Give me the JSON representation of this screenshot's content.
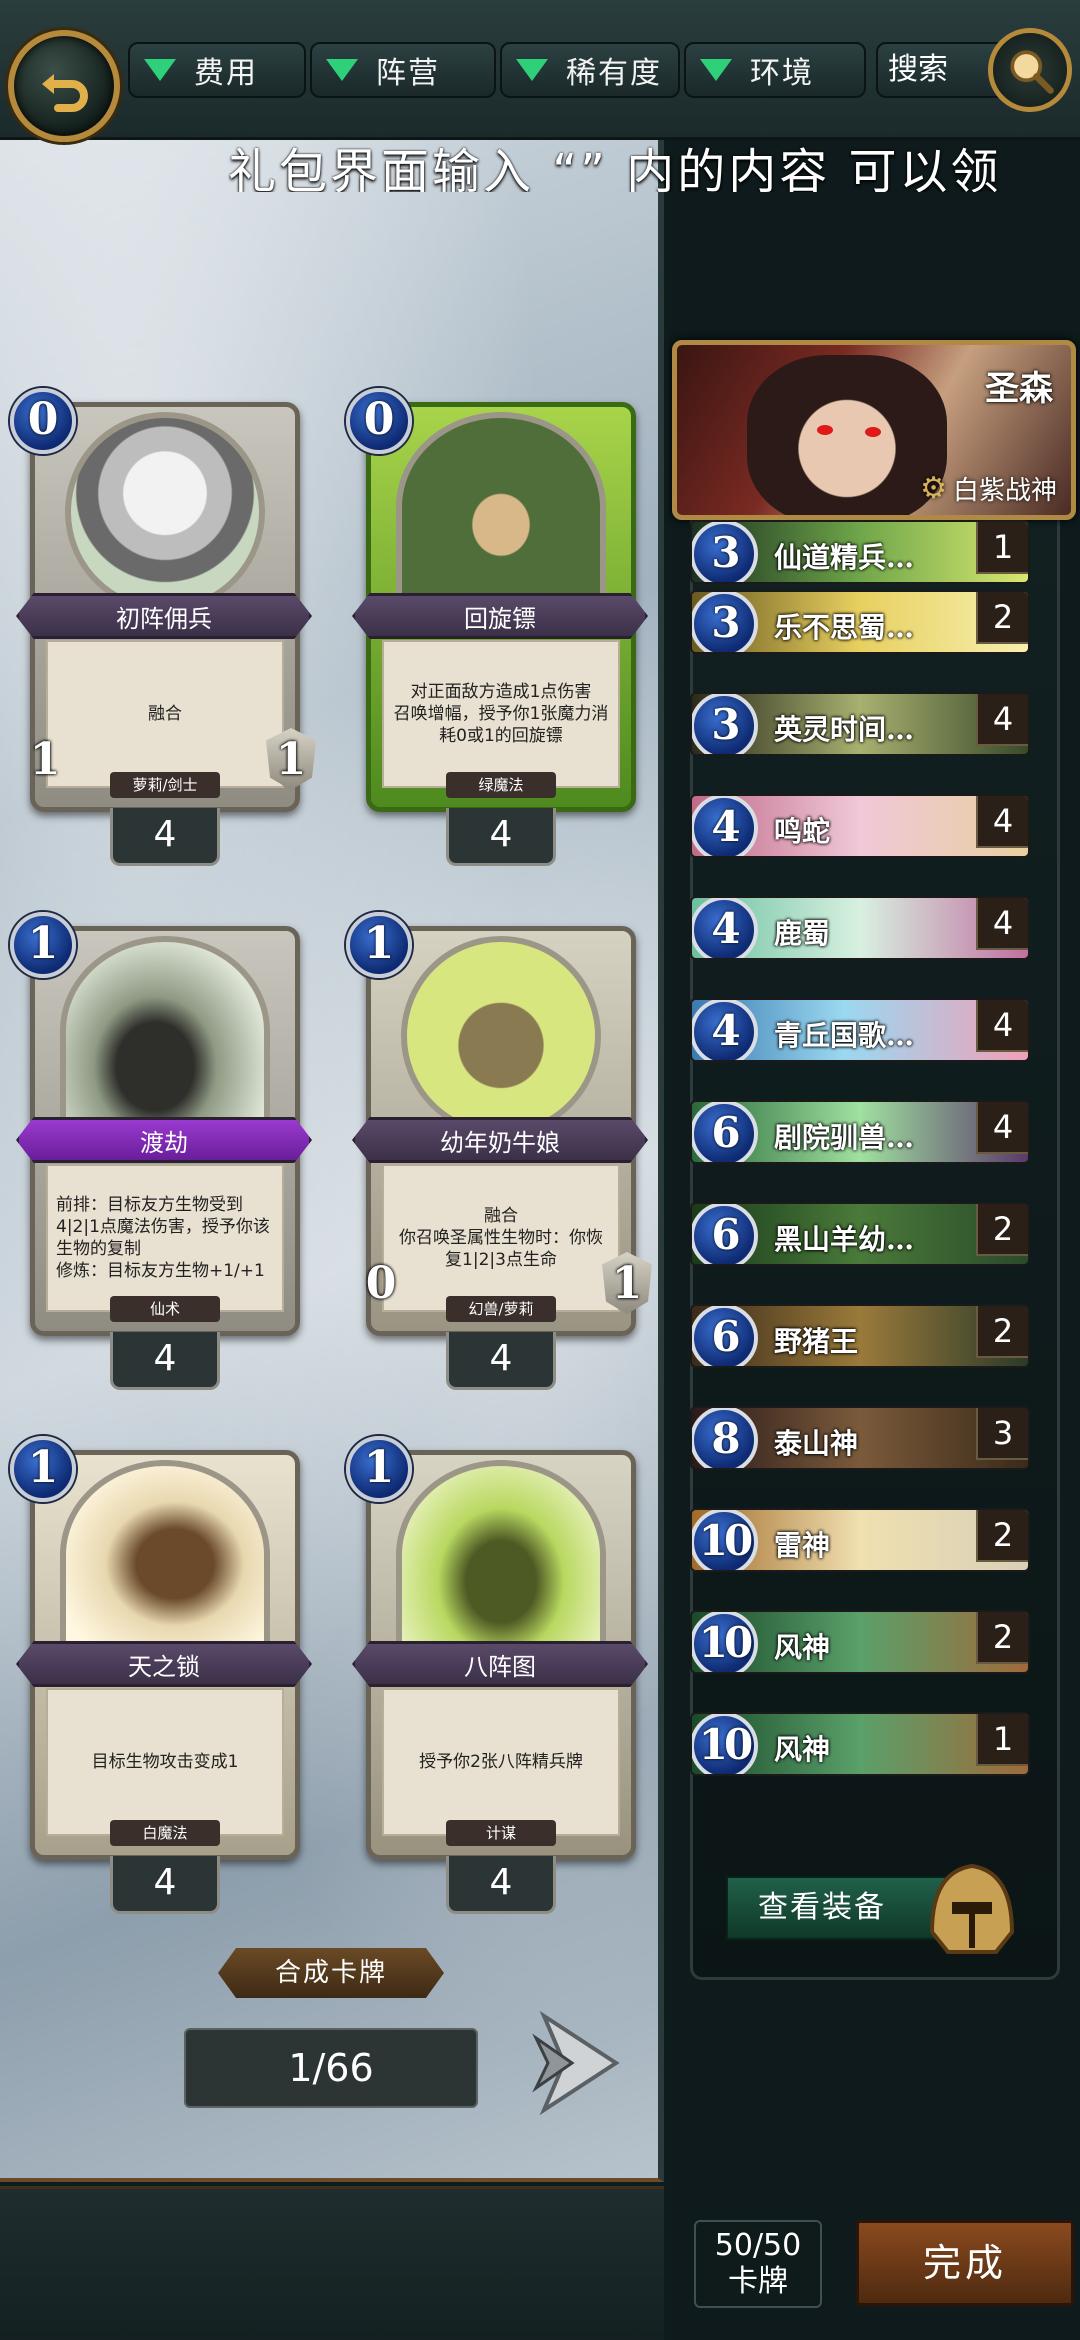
{
  "filters": {
    "cost": "费用",
    "faction": "阵营",
    "rarity": "稀有度",
    "environment": "环境",
    "search": "搜索"
  },
  "banner": "礼包界面输入 “” 内的内容 可以领",
  "cards": [
    {
      "cost": "0",
      "name": "初阵佣兵",
      "text": "融合",
      "tribe": "萝莉/剑士",
      "atk": "1",
      "hp": "1",
      "count": "4"
    },
    {
      "cost": "0",
      "name": "回旋镖",
      "text": "对正面敌方造成1点伤害\n召唤增幅，授予你1张魔力消耗0或1的回旋镖",
      "tribe": "绿魔法",
      "atk": "",
      "hp": "",
      "count": "4"
    },
    {
      "cost": "1",
      "name": "渡劫",
      "text": "前排：目标友方生物受到4|2|1点魔法伤害，授予你该生物的复制\n修炼：目标友方生物+1/+1",
      "tribe": "仙术",
      "atk": "",
      "hp": "",
      "count": "4"
    },
    {
      "cost": "1",
      "name": "幼年奶牛娘",
      "text": "融合\n你召唤圣属性生物时：你恢复1|2|3点生命",
      "tribe": "幻兽/萝莉",
      "atk": "0",
      "hp": "1",
      "count": "4"
    },
    {
      "cost": "1",
      "name": "天之锁",
      "text": "目标生物攻击变成1",
      "tribe": "白魔法",
      "atk": "",
      "hp": "",
      "count": "4"
    },
    {
      "cost": "1",
      "name": "八阵图",
      "text": "授予你2张八阵精兵牌",
      "tribe": "计谋",
      "atk": "",
      "hp": "",
      "count": "4"
    }
  ],
  "synthesize_label": "合成卡牌",
  "page_indicator": "1/66",
  "hero": {
    "name": "圣森",
    "title": "白紫战神"
  },
  "deck": [
    {
      "cost": "3",
      "name": "仙道精兵…",
      "count": "1"
    },
    {
      "cost": "3",
      "name": "乐不思蜀…",
      "count": "2"
    },
    {
      "cost": "3",
      "name": "英灵时间…",
      "count": "4"
    },
    {
      "cost": "4",
      "name": "鸣蛇",
      "count": "4"
    },
    {
      "cost": "4",
      "name": "鹿蜀",
      "count": "4"
    },
    {
      "cost": "4",
      "name": "青丘国歌…",
      "count": "4"
    },
    {
      "cost": "6",
      "name": "剧院驯兽…",
      "count": "4"
    },
    {
      "cost": "6",
      "name": "黑山羊幼…",
      "count": "2"
    },
    {
      "cost": "6",
      "name": "野猪王",
      "count": "2"
    },
    {
      "cost": "8",
      "name": "泰山神",
      "count": "3"
    },
    {
      "cost": "10",
      "name": "雷神",
      "count": "2"
    },
    {
      "cost": "10",
      "name": "风神",
      "count": "2"
    },
    {
      "cost": "10",
      "name": "风神",
      "count": "1"
    }
  ],
  "equipment_label": "查看装备",
  "deck_count": "50/50",
  "deck_count_unit": "卡牌",
  "done_label": "完成"
}
